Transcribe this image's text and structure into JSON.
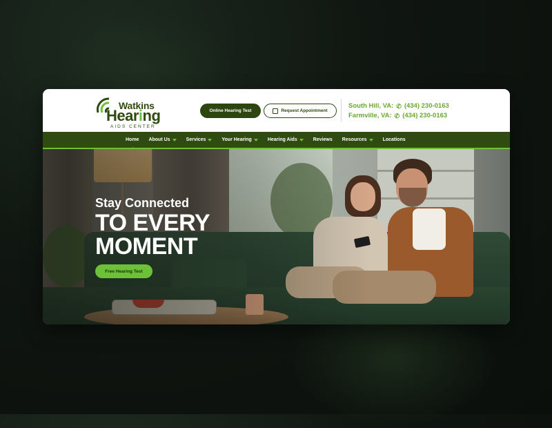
{
  "brand": {
    "logo_line1": "Watkins",
    "logo_line2_pre": "Hear",
    "logo_line2_accent": "i",
    "logo_line2_post": "ng",
    "logo_line3": "AIDS CENTER",
    "colors": {
      "dark_green": "#2d4610",
      "accent_green": "#6cc139",
      "phone_green": "#6aa830"
    }
  },
  "header": {
    "online_test_label": "Online Hearing Test",
    "appointment_label": "Request Appointment",
    "locations": [
      {
        "city": "South Hill, VA:",
        "phone": "(434) 230-0163"
      },
      {
        "city": "Farmville, VA:",
        "phone": "(434) 230-0163"
      }
    ]
  },
  "nav": {
    "items": [
      {
        "label": "Home",
        "dropdown": false,
        "active": true
      },
      {
        "label": "About Us",
        "dropdown": true
      },
      {
        "label": "Services",
        "dropdown": true
      },
      {
        "label": "Your Hearing",
        "dropdown": true
      },
      {
        "label": "Hearing Aids",
        "dropdown": true
      },
      {
        "label": "Reviews",
        "dropdown": false
      },
      {
        "label": "Resources",
        "dropdown": true
      },
      {
        "label": "Locations",
        "dropdown": false
      }
    ]
  },
  "hero": {
    "subtitle": "Stay Connected",
    "title_line1": "TO EVERY",
    "title_line2": "MOMENT",
    "cta_label": "Free Hearing Test"
  },
  "icons": [
    "ear-logo-icon",
    "calendar-icon",
    "phone-icon",
    "chevron-down-icon"
  ]
}
